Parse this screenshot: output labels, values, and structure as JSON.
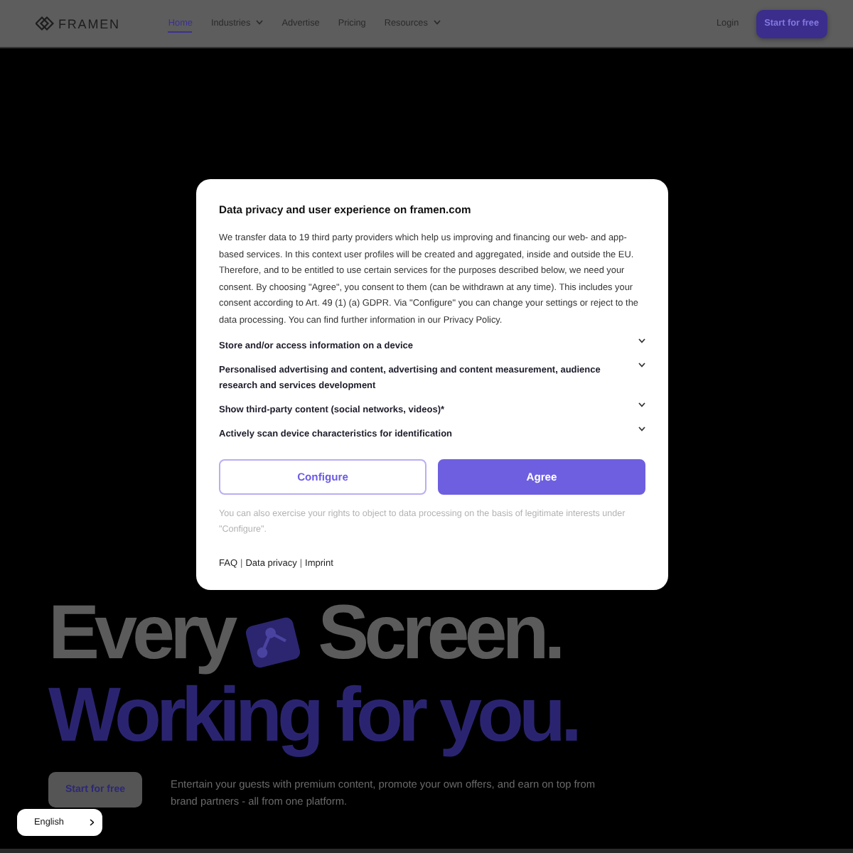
{
  "header": {
    "logo": "FRAMEN",
    "nav": [
      {
        "label": "Home",
        "selected": true,
        "dropdown": false
      },
      {
        "label": "Industries",
        "selected": false,
        "dropdown": true
      },
      {
        "label": "Advertise",
        "selected": false,
        "dropdown": false
      },
      {
        "label": "Pricing",
        "selected": false,
        "dropdown": false
      },
      {
        "label": "Resources",
        "selected": false,
        "dropdown": true
      }
    ],
    "login": "Login",
    "cta": "Start for free"
  },
  "hero": {
    "headline_start": "Every",
    "headline_end": "Screen.",
    "subheadline": "Working for you.",
    "cta": "Start for free",
    "description": "Entertain your guests with premium content, promote your own offers, and earn on top from brand partners - all from one platform."
  },
  "consent_dialog": {
    "title": "Data privacy and user experience on framen.com",
    "body": "We transfer data to 19 third party providers which help us improving and financing our web- and app-based services. In this context user profiles will be created and aggregated, inside and outside the EU. Therefore, and to be entitled to use certain services for the purposes described below, we need your consent. By choosing \"Agree\", you consent to them (can be withdrawn at any time). This includes your consent according to Art. 49 (1) (a) GDPR. Via \"Configure\" you can change your settings or reject to the data processing. You can find further information in our Privacy Policy.",
    "purposes": [
      {
        "label": "Store and/or access information on a device",
        "expanded": false
      },
      {
        "label": "Personalised advertising and content, advertising and content measurement, audience research and services development",
        "expanded": false
      },
      {
        "label": "Show third-party content (social networks, videos)*",
        "expanded": false
      },
      {
        "label": "Actively scan device characteristics for identification",
        "expanded": false
      }
    ],
    "buttons": [
      {
        "label": "Configure",
        "kind": "outline"
      },
      {
        "label": "Agree",
        "kind": "primary"
      }
    ],
    "note": "You can also exercise your rights to object to data processing on the basis of legitimate interests under \"Configure\".",
    "footer": [
      {
        "kind": "link",
        "text": "FAQ"
      },
      {
        "kind": "separator",
        "text": "|"
      },
      {
        "kind": "link",
        "text": "Data privacy"
      },
      {
        "kind": "separator",
        "text": "|"
      },
      {
        "kind": "link",
        "text": "Imprint"
      }
    ]
  },
  "language_selector": {
    "value": "English"
  }
}
